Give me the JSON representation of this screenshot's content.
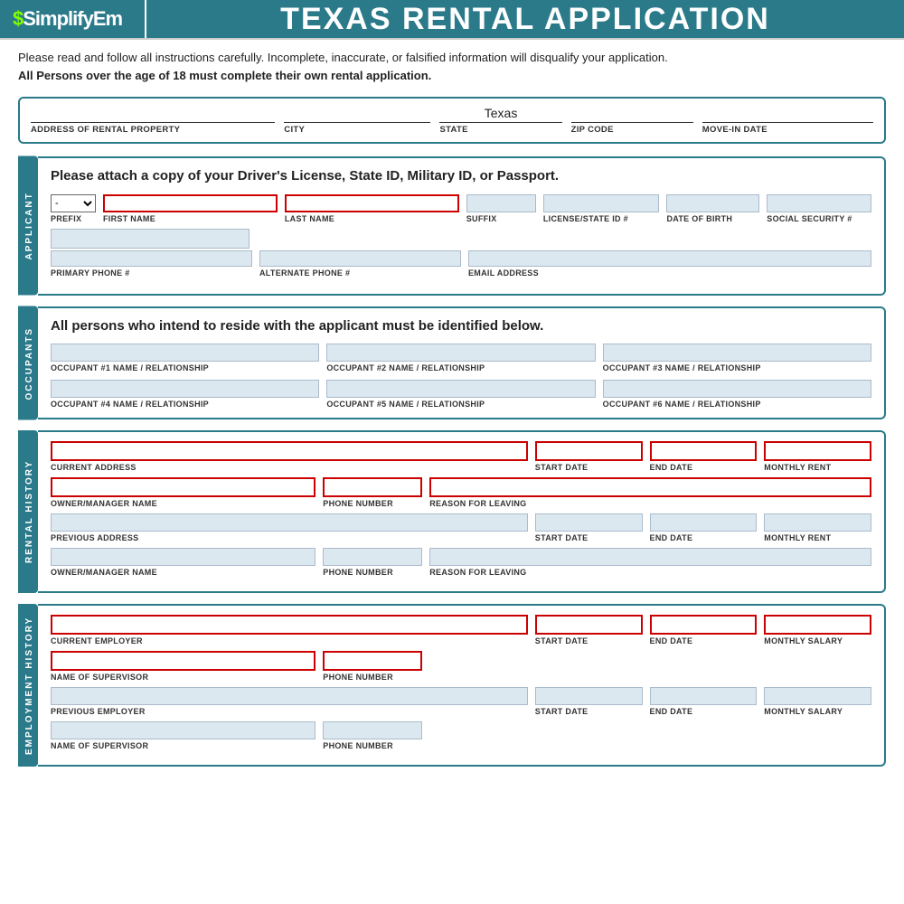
{
  "header": {
    "logo": "SimplifyEm",
    "logo_dollar": "$",
    "title": "TEXAS RENTAL APPLICATION"
  },
  "disclaimer": {
    "line1": "Please read and follow all instructions carefully. Incomplete, inaccurate, or falsified information will disqualify your application.",
    "line2": "All Persons over the age of 18 must complete their own rental application."
  },
  "property": {
    "state_value": "Texas",
    "labels": {
      "address": "ADDRESS OF RENTAL PROPERTY",
      "city": "CITY",
      "state": "STATE",
      "zip": "ZIP CODE",
      "move_in": "MOVE-IN DATE"
    }
  },
  "applicant": {
    "side_label": "APPLICANT",
    "header": "Please attach a copy of your Driver's License, State ID, Military ID, or Passport.",
    "labels": {
      "prefix": "PREFIX",
      "first_name": "FIRST NAME",
      "last_name": "LAST NAME",
      "suffix": "SUFFIX",
      "license": "LICENSE/STATE ID #",
      "dob": "DATE OF BIRTH",
      "ssn": "SOCIAL SECURITY #",
      "primary_phone": "PRIMARY PHONE #",
      "alt_phone": "ALTERNATE PHONE #",
      "email": "EMAIL ADDRESS"
    }
  },
  "occupants": {
    "side_label": "OCCUPANTS",
    "header": "All persons who intend to reside with the applicant must be identified below.",
    "labels": {
      "occ1": "OCCUPANT #1 NAME / RELATIONSHIP",
      "occ2": "OCCUPANT #2 NAME / RELATIONSHIP",
      "occ3": "OCCUPANT #3 NAME / RELATIONSHIP",
      "occ4": "OCCUPANT #4 NAME / RELATIONSHIP",
      "occ5": "OCCUPANT #5 NAME / RELATIONSHIP",
      "occ6": "OCCUPANT #6 NAME / RELATIONSHIP"
    }
  },
  "rental_history": {
    "side_label": "RENTAL HISTORY",
    "labels": {
      "current_address": "CURRENT ADDRESS",
      "start_date": "START DATE",
      "end_date": "END DATE",
      "monthly_rent": "MONTHLY RENT",
      "owner_manager": "OWNER/MANAGER NAME",
      "phone": "PHONE NUMBER",
      "reason": "REASON FOR LEAVING",
      "prev_address": "PREVIOUS ADDRESS",
      "prev_start": "START DATE",
      "prev_end": "END DATE",
      "prev_rent": "MONTHLY RENT",
      "prev_owner": "OWNER/MANAGER NAME",
      "prev_phone": "PHONE NUMBER",
      "prev_reason": "REASON FOR LEAVING"
    }
  },
  "employment_history": {
    "side_label": "EMPLOYMENT HISTORY",
    "labels": {
      "current_employer": "CURRENT EMPLOYER",
      "start_date": "START DATE",
      "end_date": "END DATE",
      "monthly_salary": "MONTHLY SALARY",
      "supervisor": "NAME OF SUPERVISOR",
      "phone": "PHONE NUMBER",
      "prev_employer": "PREVIOUS EMPLOYER",
      "prev_start": "START DATE",
      "prev_end": "END DATE",
      "prev_salary": "MONTHLY SALARY",
      "prev_supervisor": "NAME OF SUPERVISOR",
      "prev_phone": "PHONE NUMBER"
    }
  }
}
